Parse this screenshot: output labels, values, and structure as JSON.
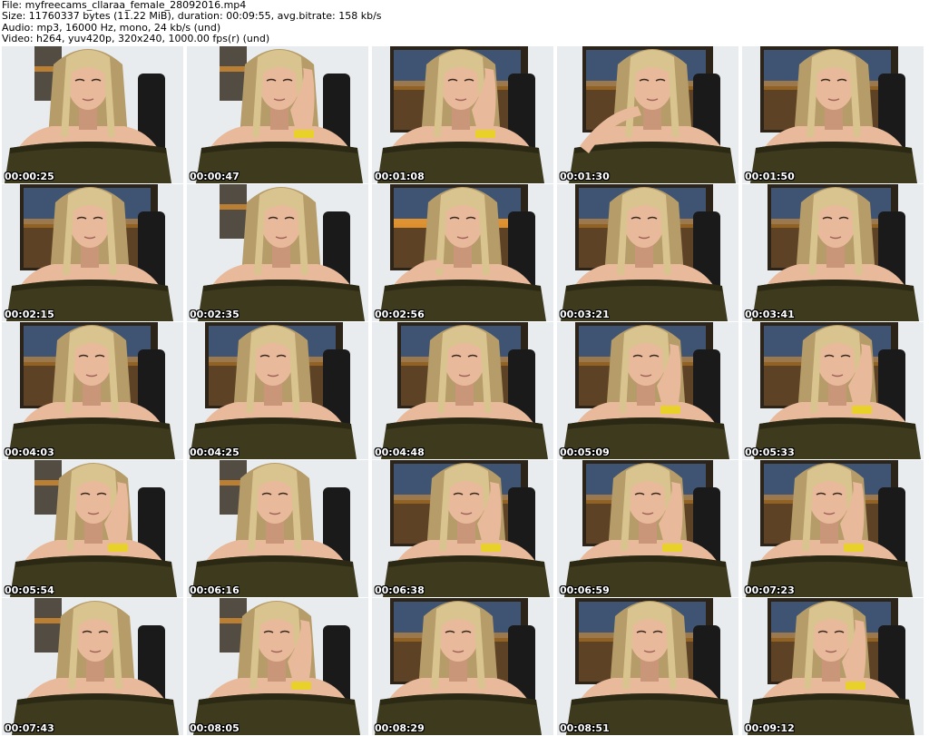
{
  "header": {
    "file": "File: myfreecams_cllaraa_female_28092016.mp4",
    "size": "Size: 11760337 bytes (11.22 MiB), duration: 00:09:55, avg.bitrate: 158 kb/s",
    "audio": "Audio: mp3, 16000 Hz, mono, 24 kb/s (und)",
    "video": "Video: h264, yuv420p, 320x240, 1000.00 fps(r) (und)"
  },
  "thumbnails": [
    {
      "timestamp": "00:00:25",
      "pose": "plain",
      "bg": "wall"
    },
    {
      "timestamp": "00:00:47",
      "pose": "hand-chin",
      "bg": "wall"
    },
    {
      "timestamp": "00:01:08",
      "pose": "hand-chin",
      "bg": "poster"
    },
    {
      "timestamp": "00:01:30",
      "pose": "hand-neck",
      "bg": "poster"
    },
    {
      "timestamp": "00:01:50",
      "pose": "plain",
      "bg": "poster"
    },
    {
      "timestamp": "00:02:15",
      "pose": "plain",
      "bg": "poster"
    },
    {
      "timestamp": "00:02:35",
      "pose": "plain",
      "bg": "wall"
    },
    {
      "timestamp": "00:02:56",
      "pose": "hand-shoulder",
      "bg": "sunset"
    },
    {
      "timestamp": "00:03:21",
      "pose": "plain",
      "bg": "poster"
    },
    {
      "timestamp": "00:03:41",
      "pose": "plain",
      "bg": "poster"
    },
    {
      "timestamp": "00:04:03",
      "pose": "plain",
      "bg": "poster"
    },
    {
      "timestamp": "00:04:25",
      "pose": "plain",
      "bg": "poster"
    },
    {
      "timestamp": "00:04:48",
      "pose": "plain",
      "bg": "poster"
    },
    {
      "timestamp": "00:05:09",
      "pose": "hand-chin",
      "bg": "poster"
    },
    {
      "timestamp": "00:05:33",
      "pose": "hand-chin",
      "bg": "poster"
    },
    {
      "timestamp": "00:05:54",
      "pose": "hand-chin",
      "bg": "wall"
    },
    {
      "timestamp": "00:06:16",
      "pose": "plain",
      "bg": "wall"
    },
    {
      "timestamp": "00:06:38",
      "pose": "hand-chin",
      "bg": "poster"
    },
    {
      "timestamp": "00:06:59",
      "pose": "hand-chin",
      "bg": "poster"
    },
    {
      "timestamp": "00:07:23",
      "pose": "hand-chin",
      "bg": "poster"
    },
    {
      "timestamp": "00:07:43",
      "pose": "plain",
      "bg": "wall"
    },
    {
      "timestamp": "00:08:05",
      "pose": "hand-chin",
      "bg": "wall"
    },
    {
      "timestamp": "00:08:29",
      "pose": "plain",
      "bg": "poster"
    },
    {
      "timestamp": "00:08:51",
      "pose": "plain",
      "bg": "poster"
    },
    {
      "timestamp": "00:09:12",
      "pose": "hand-chin",
      "bg": "poster"
    }
  ],
  "colors": {
    "wall": "#e9ecef",
    "poster_dark": "#2c2418",
    "poster_mid": "#6b4a2a",
    "sky": "#4a6fa5",
    "sunset": "#e8962e",
    "hair": "#d9c48f",
    "hair_dark": "#b59c68",
    "skin": "#e8b99a",
    "skin_shadow": "#c9967a",
    "top": "#3d3a1e",
    "top_dark": "#2b2914",
    "chair": "#1a1a1a",
    "watch": "#e8d22a"
  }
}
